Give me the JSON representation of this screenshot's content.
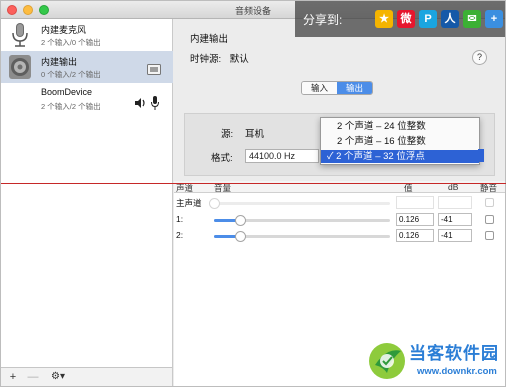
{
  "window": {
    "title": "音频设备"
  },
  "share": {
    "label": "分享到:",
    "icons": [
      {
        "name": "qzone-icon",
        "glyph": "★",
        "color": "#f5b400"
      },
      {
        "name": "weibo-icon",
        "glyph": "微",
        "color": "#e6162d"
      },
      {
        "name": "tencent-icon",
        "glyph": "P",
        "color": "#1aa5e0"
      },
      {
        "name": "renren-icon",
        "glyph": "人",
        "color": "#1559a8"
      },
      {
        "name": "wechat-icon",
        "glyph": "✉",
        "color": "#3cb034"
      },
      {
        "name": "more-icon",
        "glyph": "+",
        "color": "#3b8fe0"
      }
    ]
  },
  "devices": [
    {
      "name": "内建麦克风",
      "sub": "2 个输入/0 个输出",
      "icon": "microphone-icon",
      "selected": false
    },
    {
      "name": "内建输出",
      "sub": "0 个输入/2 个输出",
      "icon": "speaker-icon",
      "selected": true
    },
    {
      "name": "BoomDevice",
      "sub": "2 个输入/2 个输出",
      "icon": "device-icon",
      "selected": false
    }
  ],
  "bottom_bar": {
    "add": "+",
    "remove": "—",
    "gear": "⚙▾"
  },
  "detail": {
    "title": "内建输出",
    "clock_label": "时钟源:",
    "clock_value": "默认",
    "help": "?",
    "tabs": [
      {
        "label": "输入",
        "active": false
      },
      {
        "label": "输出",
        "active": true
      }
    ],
    "source_label": "源:",
    "source_value": "耳机",
    "format_label": "格式:",
    "format_value": "44100.0 Hz"
  },
  "format_menu": {
    "options": [
      "2 个声道 – 24 位整数",
      "2 个声道 – 16 位整数",
      "✓ 2 个声道 – 32 位浮点"
    ],
    "selected_index": 2
  },
  "table": {
    "headers": [
      "声道",
      "音量",
      "值",
      "dB",
      "静音"
    ],
    "rows": [
      {
        "channel": "主声道",
        "level": 0,
        "value": "",
        "db": "",
        "enabled": false
      },
      {
        "channel": "1:",
        "level": 0.15,
        "value": "0.126",
        "db": "-41",
        "enabled": true
      },
      {
        "channel": "2:",
        "level": 0.15,
        "value": "0.126",
        "db": "-41",
        "enabled": true
      }
    ]
  },
  "watermark": {
    "title": "当客软件园",
    "url": "www.downkr.com"
  },
  "colors": {
    "accent": "#4c8de8",
    "highlight": "#2d62d5",
    "selection": "#cfd9e8",
    "annotation_line": "#c62828"
  }
}
